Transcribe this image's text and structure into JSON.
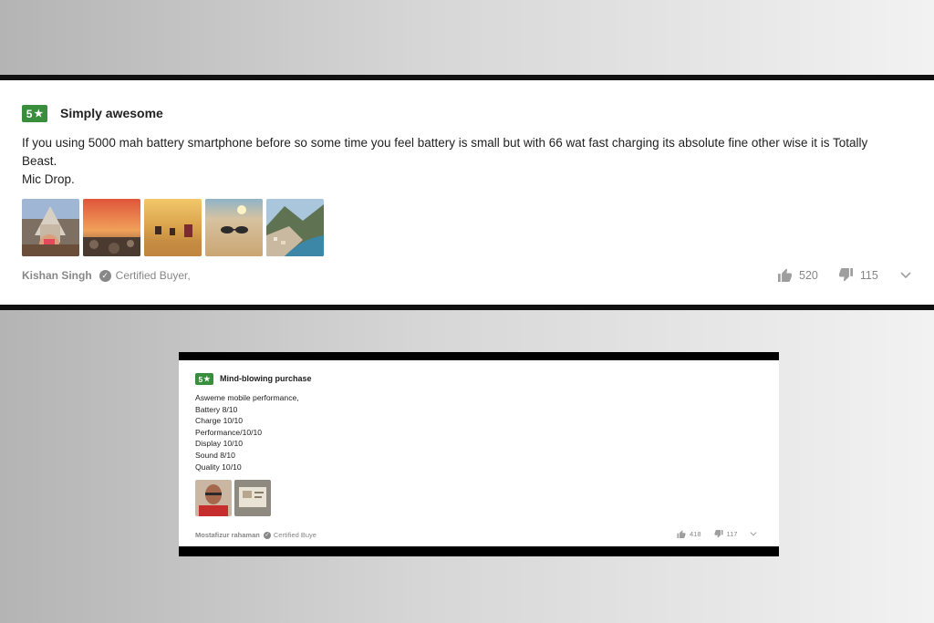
{
  "review1": {
    "rating": "5",
    "star_icon": "star-icon",
    "title": "Simply awesome",
    "body_lines": [
      "If you using 5000 mah battery smartphone before so some time you feel battery is small but with 66 wat fast charging its absolute fine other wise it is Totally",
      "Beast.",
      "Mic Drop."
    ],
    "photos": [
      "temple-photo",
      "sunset-photo",
      "beach-boats-photo",
      "sunglasses-sand-photo",
      "coastal-town-photo"
    ],
    "reviewer": "Kishan Singh",
    "certified": "Certified Buyer,",
    "likes": "520",
    "dislikes": "115"
  },
  "review2": {
    "rating": "5",
    "star_icon": "star-icon",
    "title": "Mind-blowing purchase",
    "body_lines": [
      "Asweme mobile performance,",
      "Battery 8/10",
      "Charge 10/10",
      "Performance/10/10",
      "Display 10/10",
      "Sound 8/10",
      "Quality 10/10"
    ],
    "photos": [
      "reviewer-selfie-photo",
      "phone-box-photo"
    ],
    "reviewer": "Mostafizur rahaman",
    "certified": "Certified Buye",
    "likes": "418",
    "dislikes": "117"
  },
  "colors": {
    "badge_green": "#388e3c",
    "muted_gray": "#878787",
    "frame_black": "#000000"
  },
  "icons": [
    "star-icon",
    "check-circle-icon",
    "thumbs-up-icon",
    "thumbs-down-icon",
    "chevron-down-icon"
  ]
}
